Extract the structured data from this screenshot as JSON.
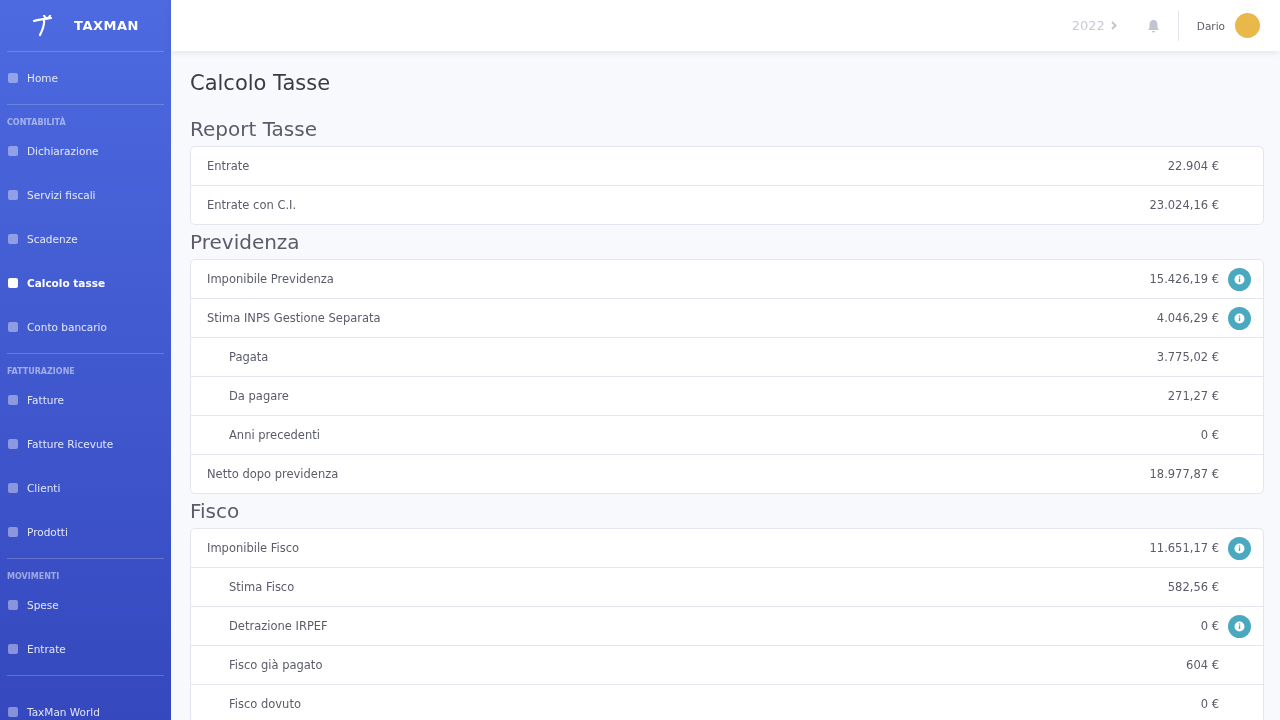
{
  "brand": "TAXMAN",
  "sidebar": {
    "sections": [
      {
        "items": [
          {
            "label": "Home",
            "selected": false
          }
        ]
      },
      {
        "title": "CONTABILITÀ",
        "items": [
          {
            "label": "Dichiarazione",
            "selected": false
          },
          {
            "label": "Servizi fiscali",
            "selected": false
          },
          {
            "label": "Scadenze",
            "selected": false
          },
          {
            "label": "Calcolo tasse",
            "selected": true
          },
          {
            "label": "Conto bancario",
            "selected": false
          }
        ]
      },
      {
        "title": "FATTURAZIONE",
        "items": [
          {
            "label": "Fatture",
            "selected": false
          },
          {
            "label": "Fatture Ricevute",
            "selected": false
          },
          {
            "label": "Clienti",
            "selected": false
          },
          {
            "label": "Prodotti",
            "selected": false
          }
        ]
      },
      {
        "title": "MOVIMENTI",
        "items": [
          {
            "label": "Spese",
            "selected": false
          },
          {
            "label": "Entrate",
            "selected": false
          }
        ]
      },
      {
        "items": [
          {
            "label": "TaxMan World",
            "selected": false
          }
        ]
      }
    ]
  },
  "header": {
    "year": "2022",
    "user": "Dario"
  },
  "page_title": "Calcolo Tasse",
  "sections": [
    {
      "title": "Report Tasse",
      "rows": [
        {
          "label": "Entrate",
          "value": "22.904 €",
          "info": false
        },
        {
          "label": "Entrate con C.I.",
          "value": "23.024,16 €",
          "info": false
        }
      ]
    },
    {
      "title": "Previdenza",
      "rows": [
        {
          "label": "Imponibile Previdenza",
          "value": "15.426,19 €",
          "info": true
        },
        {
          "label": "Stima INPS Gestione Separata",
          "value": "4.046,29 €",
          "info": true,
          "children": [
            {
              "label": "Pagata",
              "value": "3.775,02 €",
              "info": false
            },
            {
              "label": "Da pagare",
              "value": "271,27 €",
              "info": false
            },
            {
              "label": "Anni precedenti",
              "value": "0 €",
              "info": false
            }
          ]
        },
        {
          "label": "Netto dopo previdenza",
          "value": "18.977,87 €",
          "info": false
        }
      ]
    },
    {
      "title": "Fisco",
      "rows": [
        {
          "label": "Imponibile Fisco",
          "value": "11.651,17 €",
          "info": true,
          "children": [
            {
              "label": "Stima Fisco",
              "value": "582,56 €",
              "info": false
            },
            {
              "label": "Detrazione IRPEF",
              "value": "0 €",
              "info": true
            },
            {
              "label": "Fisco già pagato",
              "value": "604 €",
              "info": false
            },
            {
              "label": "Fisco dovuto",
              "value": "0 €",
              "info": false
            }
          ]
        }
      ]
    }
  ]
}
